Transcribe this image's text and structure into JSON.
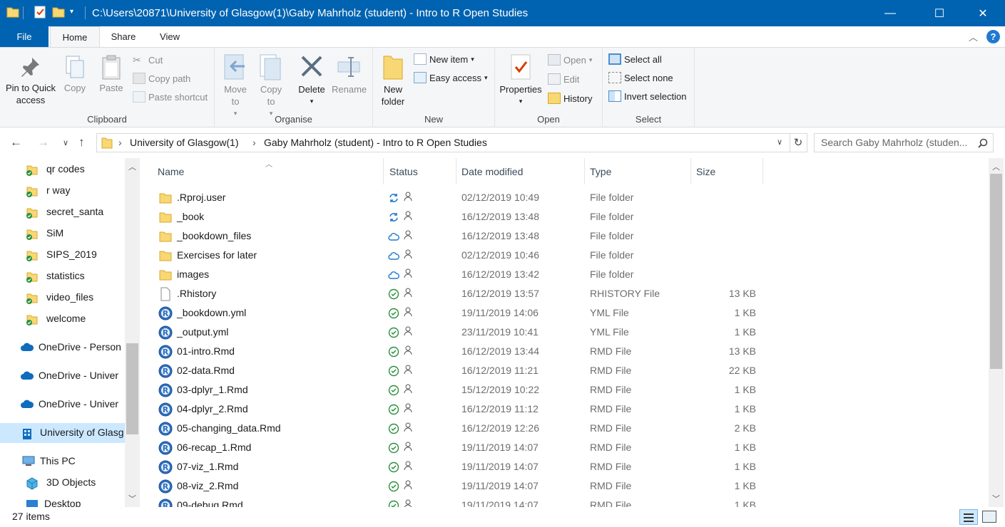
{
  "window": {
    "title": "C:\\Users\\20871\\University of Glasgow(1)\\Gaby Mahrholz (student) - Intro to R Open Studies",
    "minimize": "—",
    "maximize": "☐",
    "close": "✕"
  },
  "tabs": {
    "file": "File",
    "home": "Home",
    "share": "Share",
    "view": "View"
  },
  "ribbon": {
    "clipboard": {
      "label": "Clipboard",
      "pin": "Pin to Quick access",
      "copy": "Copy",
      "paste": "Paste",
      "cut": "Cut",
      "copy_path": "Copy path",
      "paste_shortcut": "Paste shortcut"
    },
    "organise": {
      "label": "Organise",
      "move_to": "Move to",
      "copy_to": "Copy to",
      "delete": "Delete",
      "rename": "Rename"
    },
    "new": {
      "label": "New",
      "new_folder": "New folder",
      "new_item": "New item",
      "easy_access": "Easy access"
    },
    "open": {
      "label": "Open",
      "properties": "Properties",
      "open": "Open",
      "edit": "Edit",
      "history": "History"
    },
    "select": {
      "label": "Select",
      "select_all": "Select all",
      "select_none": "Select none",
      "invert": "Invert selection"
    }
  },
  "address": {
    "crumbs": [
      "University of Glasgow(1)",
      "Gaby Mahrholz (student) - Intro to R Open Studies"
    ],
    "search_placeholder": "Search Gaby Mahrholz (studen..."
  },
  "sidebar": {
    "items": [
      {
        "label": "qr codes",
        "icon": "folder-synced-icon"
      },
      {
        "label": "r way",
        "icon": "folder-synced-icon"
      },
      {
        "label": "secret_santa",
        "icon": "folder-synced-icon"
      },
      {
        "label": "SiM",
        "icon": "folder-synced-icon"
      },
      {
        "label": "SIPS_2019",
        "icon": "folder-synced-icon"
      },
      {
        "label": "statistics",
        "icon": "folder-synced-icon"
      },
      {
        "label": "video_files",
        "icon": "folder-synced-icon"
      },
      {
        "label": "welcome",
        "icon": "folder-synced-icon"
      },
      {
        "label": "OneDrive - Person",
        "icon": "onedrive-icon"
      },
      {
        "label": "OneDrive - Univer",
        "icon": "onedrive-icon"
      },
      {
        "label": "OneDrive - Univer",
        "icon": "onedrive-icon"
      },
      {
        "label": "University of Glasg",
        "icon": "building-icon"
      },
      {
        "label": "This PC",
        "icon": "pc-icon"
      },
      {
        "label": "3D Objects",
        "icon": "cube-icon"
      },
      {
        "label": "Desktop",
        "icon": "desktop-icon"
      }
    ]
  },
  "columns": {
    "name": "Name",
    "status": "Status",
    "date": "Date modified",
    "type": "Type",
    "size": "Size"
  },
  "files": [
    {
      "name": ".Rproj.user",
      "status": "syncing",
      "date": "02/12/2019 10:49",
      "type": "File folder",
      "size": "",
      "icon": "folder"
    },
    {
      "name": "_book",
      "status": "syncing",
      "date": "16/12/2019 13:48",
      "type": "File folder",
      "size": "",
      "icon": "folder"
    },
    {
      "name": "_bookdown_files",
      "status": "cloud",
      "date": "16/12/2019 13:48",
      "type": "File folder",
      "size": "",
      "icon": "folder"
    },
    {
      "name": "Exercises for later",
      "status": "cloud",
      "date": "02/12/2019 10:46",
      "type": "File folder",
      "size": "",
      "icon": "folder"
    },
    {
      "name": "images",
      "status": "cloud",
      "date": "16/12/2019 13:42",
      "type": "File folder",
      "size": "",
      "icon": "folder"
    },
    {
      "name": ".Rhistory",
      "status": "synced",
      "date": "16/12/2019 13:57",
      "type": "RHISTORY File",
      "size": "13 KB",
      "icon": "doc"
    },
    {
      "name": "_bookdown.yml",
      "status": "synced",
      "date": "19/11/2019 14:06",
      "type": "YML File",
      "size": "1 KB",
      "icon": "r"
    },
    {
      "name": "_output.yml",
      "status": "synced",
      "date": "23/11/2019 10:41",
      "type": "YML File",
      "size": "1 KB",
      "icon": "r"
    },
    {
      "name": "01-intro.Rmd",
      "status": "synced",
      "date": "16/12/2019 13:44",
      "type": "RMD File",
      "size": "13 KB",
      "icon": "r"
    },
    {
      "name": "02-data.Rmd",
      "status": "synced",
      "date": "16/12/2019 11:21",
      "type": "RMD File",
      "size": "22 KB",
      "icon": "r"
    },
    {
      "name": "03-dplyr_1.Rmd",
      "status": "synced",
      "date": "15/12/2019 10:22",
      "type": "RMD File",
      "size": "1 KB",
      "icon": "r"
    },
    {
      "name": "04-dplyr_2.Rmd",
      "status": "synced",
      "date": "16/12/2019 11:12",
      "type": "RMD File",
      "size": "1 KB",
      "icon": "r"
    },
    {
      "name": "05-changing_data.Rmd",
      "status": "synced",
      "date": "16/12/2019 12:26",
      "type": "RMD File",
      "size": "2 KB",
      "icon": "r"
    },
    {
      "name": "06-recap_1.Rmd",
      "status": "synced",
      "date": "19/11/2019 14:07",
      "type": "RMD File",
      "size": "1 KB",
      "icon": "r"
    },
    {
      "name": "07-viz_1.Rmd",
      "status": "synced",
      "date": "19/11/2019 14:07",
      "type": "RMD File",
      "size": "1 KB",
      "icon": "r"
    },
    {
      "name": "08-viz_2.Rmd",
      "status": "synced",
      "date": "19/11/2019 14:07",
      "type": "RMD File",
      "size": "1 KB",
      "icon": "r"
    },
    {
      "name": "09-debug.Rmd",
      "status": "synced",
      "date": "19/11/2019 14:07",
      "type": "RMD File",
      "size": "1 KB",
      "icon": "r"
    }
  ],
  "status": {
    "items": "27 items"
  },
  "colors": {
    "titlebar": "#0063b1",
    "selection": "#cce8ff",
    "synced": "#2a8f3c",
    "cloud": "#1e7ad0"
  }
}
